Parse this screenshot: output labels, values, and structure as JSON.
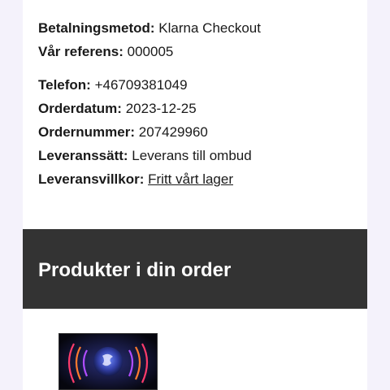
{
  "order_info": {
    "payment": {
      "label": "Betalningsmetod:",
      "value": "Klarna Checkout"
    },
    "reference": {
      "label": "Vår referens:",
      "value": "000005"
    },
    "phone": {
      "label": "Telefon:",
      "value": "+46709381049"
    },
    "order_date": {
      "label": "Orderdatum:",
      "value": "2023-12-25"
    },
    "order_number": {
      "label": "Ordernummer:",
      "value": "207429960"
    },
    "delivery_method": {
      "label": "Leveranssätt:",
      "value": "Leverans till ombud"
    },
    "delivery_terms": {
      "label": "Leveransvillkor:",
      "value": "Fritt vårt lager"
    }
  },
  "products_section": {
    "title": "Produkter i din order"
  },
  "colors": {
    "page_background": "#f4f2fb",
    "card_background": "#ffffff",
    "section_header_background": "#333333",
    "text": "#1a1a1a"
  }
}
